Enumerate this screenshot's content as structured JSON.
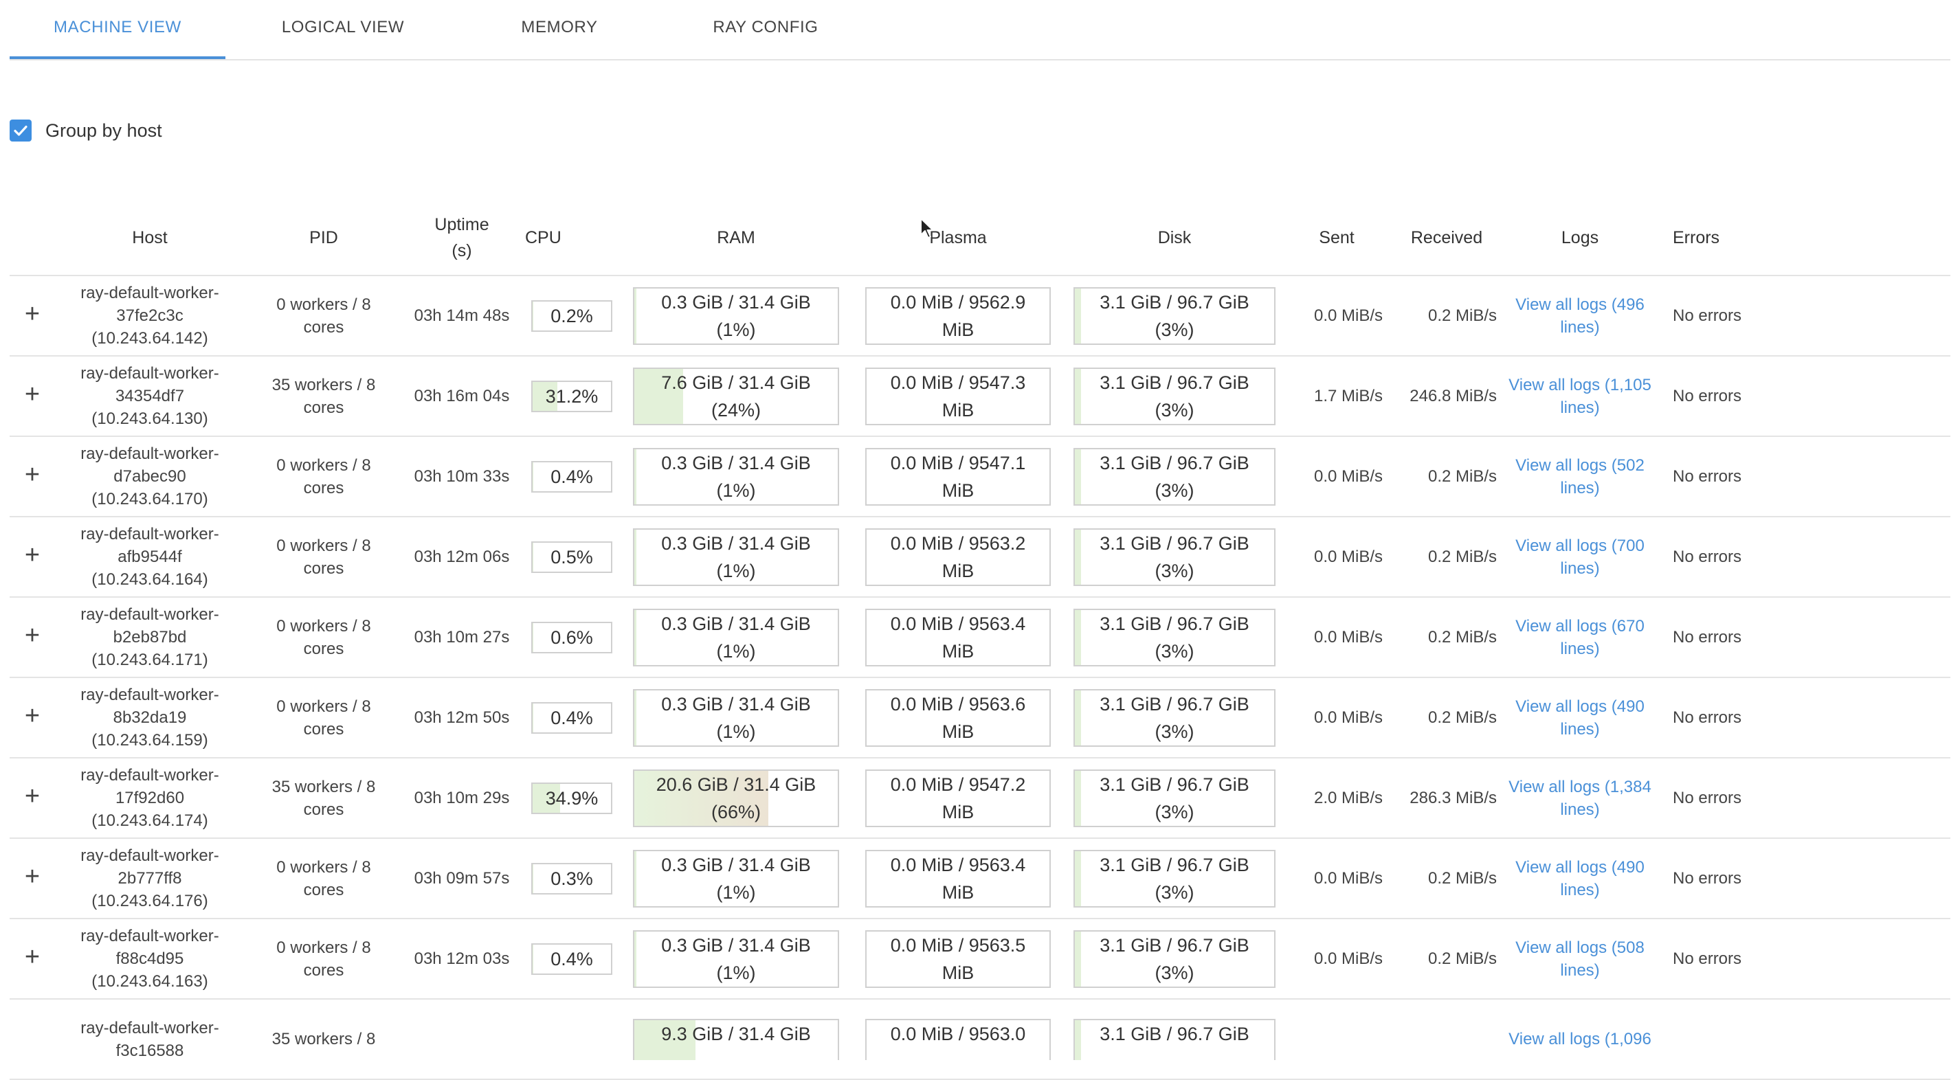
{
  "tabs": [
    "MACHINE VIEW",
    "LOGICAL VIEW",
    "MEMORY",
    "RAY CONFIG"
  ],
  "group_by_host": {
    "label": "Group by host",
    "checked": true
  },
  "columns": [
    "Host",
    "PID",
    "Uptime (s)",
    "CPU",
    "RAM",
    "Plasma",
    "Disk",
    "Sent",
    "Received",
    "Logs",
    "Errors"
  ],
  "rows": [
    {
      "host": "ray-default-worker-37fe2c3c",
      "ip": "(10.243.64.142)",
      "pid_line1": "0 workers / 8",
      "pid_line2": "cores",
      "uptime": "03h 14m 48s",
      "cpu": "0.2%",
      "cpu_pct": 0.2,
      "ram_line1": "0.3 GiB / 31.4 GiB",
      "ram_line2": "(1%)",
      "ram_pct": 1,
      "plasma_line1": "0.0 MiB / 9562.9",
      "plasma_line2": "MiB",
      "disk_line1": "3.1 GiB / 96.7 GiB",
      "disk_line2": "(3%)",
      "disk_pct": 3,
      "sent": "0.0 MiB/s",
      "received": "0.2 MiB/s",
      "logs_line1": "View all logs (496",
      "logs_line2": "lines)",
      "errors": "No errors"
    },
    {
      "host": "ray-default-worker-34354df7",
      "ip": "(10.243.64.130)",
      "pid_line1": "35 workers / 8",
      "pid_line2": "cores",
      "uptime": "03h 16m 04s",
      "cpu": "31.2%",
      "cpu_pct": 31.2,
      "ram_line1": "7.6 GiB / 31.4 GiB",
      "ram_line2": "(24%)",
      "ram_pct": 24,
      "plasma_line1": "0.0 MiB / 9547.3",
      "plasma_line2": "MiB",
      "disk_line1": "3.1 GiB / 96.7 GiB",
      "disk_line2": "(3%)",
      "disk_pct": 3,
      "sent": "1.7 MiB/s",
      "received": "246.8 MiB/s",
      "logs_line1": "View all logs (1,105",
      "logs_line2": "lines)",
      "errors": "No errors"
    },
    {
      "host": "ray-default-worker-d7abec90",
      "ip": "(10.243.64.170)",
      "pid_line1": "0 workers / 8",
      "pid_line2": "cores",
      "uptime": "03h 10m 33s",
      "cpu": "0.4%",
      "cpu_pct": 0.4,
      "ram_line1": "0.3 GiB / 31.4 GiB",
      "ram_line2": "(1%)",
      "ram_pct": 1,
      "plasma_line1": "0.0 MiB / 9547.1",
      "plasma_line2": "MiB",
      "disk_line1": "3.1 GiB / 96.7 GiB",
      "disk_line2": "(3%)",
      "disk_pct": 3,
      "sent": "0.0 MiB/s",
      "received": "0.2 MiB/s",
      "logs_line1": "View all logs (502",
      "logs_line2": "lines)",
      "errors": "No errors"
    },
    {
      "host": "ray-default-worker-afb9544f",
      "ip": "(10.243.64.164)",
      "pid_line1": "0 workers / 8",
      "pid_line2": "cores",
      "uptime": "03h 12m 06s",
      "cpu": "0.5%",
      "cpu_pct": 0.5,
      "ram_line1": "0.3 GiB / 31.4 GiB",
      "ram_line2": "(1%)",
      "ram_pct": 1,
      "plasma_line1": "0.0 MiB / 9563.2",
      "plasma_line2": "MiB",
      "disk_line1": "3.1 GiB / 96.7 GiB",
      "disk_line2": "(3%)",
      "disk_pct": 3,
      "sent": "0.0 MiB/s",
      "received": "0.2 MiB/s",
      "logs_line1": "View all logs (700",
      "logs_line2": "lines)",
      "errors": "No errors"
    },
    {
      "host": "ray-default-worker-b2eb87bd",
      "ip": "(10.243.64.171)",
      "pid_line1": "0 workers / 8",
      "pid_line2": "cores",
      "uptime": "03h 10m 27s",
      "cpu": "0.6%",
      "cpu_pct": 0.6,
      "ram_line1": "0.3 GiB / 31.4 GiB",
      "ram_line2": "(1%)",
      "ram_pct": 1,
      "plasma_line1": "0.0 MiB / 9563.4",
      "plasma_line2": "MiB",
      "disk_line1": "3.1 GiB / 96.7 GiB",
      "disk_line2": "(3%)",
      "disk_pct": 3,
      "sent": "0.0 MiB/s",
      "received": "0.2 MiB/s",
      "logs_line1": "View all logs (670",
      "logs_line2": "lines)",
      "errors": "No errors"
    },
    {
      "host": "ray-default-worker-8b32da19",
      "ip": "(10.243.64.159)",
      "pid_line1": "0 workers / 8",
      "pid_line2": "cores",
      "uptime": "03h 12m 50s",
      "cpu": "0.4%",
      "cpu_pct": 0.4,
      "ram_line1": "0.3 GiB / 31.4 GiB",
      "ram_line2": "(1%)",
      "ram_pct": 1,
      "plasma_line1": "0.0 MiB / 9563.6",
      "plasma_line2": "MiB",
      "disk_line1": "3.1 GiB / 96.7 GiB",
      "disk_line2": "(3%)",
      "disk_pct": 3,
      "sent": "0.0 MiB/s",
      "received": "0.2 MiB/s",
      "logs_line1": "View all logs (490",
      "logs_line2": "lines)",
      "errors": "No errors"
    },
    {
      "host": "ray-default-worker-17f92d60",
      "ip": "(10.243.64.174)",
      "pid_line1": "35 workers / 8",
      "pid_line2": "cores",
      "uptime": "03h 10m 29s",
      "cpu": "34.9%",
      "cpu_pct": 34.9,
      "ram_line1": "20.6 GiB / 31.4 GiB",
      "ram_line2": "(66%)",
      "ram_pct": 66,
      "plasma_line1": "0.0 MiB / 9547.2",
      "plasma_line2": "MiB",
      "disk_line1": "3.1 GiB / 96.7 GiB",
      "disk_line2": "(3%)",
      "disk_pct": 3,
      "sent": "2.0 MiB/s",
      "received": "286.3 MiB/s",
      "logs_line1": "View all logs (1,384",
      "logs_line2": "lines)",
      "errors": "No errors"
    },
    {
      "host": "ray-default-worker-2b777ff8",
      "ip": "(10.243.64.176)",
      "pid_line1": "0 workers / 8",
      "pid_line2": "cores",
      "uptime": "03h 09m 57s",
      "cpu": "0.3%",
      "cpu_pct": 0.3,
      "ram_line1": "0.3 GiB / 31.4 GiB",
      "ram_line2": "(1%)",
      "ram_pct": 1,
      "plasma_line1": "0.0 MiB / 9563.4",
      "plasma_line2": "MiB",
      "disk_line1": "3.1 GiB / 96.7 GiB",
      "disk_line2": "(3%)",
      "disk_pct": 3,
      "sent": "0.0 MiB/s",
      "received": "0.2 MiB/s",
      "logs_line1": "View all logs (490",
      "logs_line2": "lines)",
      "errors": "No errors"
    },
    {
      "host": "ray-default-worker-f88c4d95",
      "ip": "(10.243.64.163)",
      "pid_line1": "0 workers / 8",
      "pid_line2": "cores",
      "uptime": "03h 12m 03s",
      "cpu": "0.4%",
      "cpu_pct": 0.4,
      "ram_line1": "0.3 GiB / 31.4 GiB",
      "ram_line2": "(1%)",
      "ram_pct": 1,
      "plasma_line1": "0.0 MiB / 9563.5",
      "plasma_line2": "MiB",
      "disk_line1": "3.1 GiB / 96.7 GiB",
      "disk_line2": "(3%)",
      "disk_pct": 3,
      "sent": "0.0 MiB/s",
      "received": "0.2 MiB/s",
      "logs_line1": "View all logs (508",
      "logs_line2": "lines)",
      "errors": "No errors"
    }
  ],
  "partial_row": {
    "host": "ray-default-worker-f3c16588",
    "pid_line1": "35 workers / 8",
    "ram_line1": "9.3 GiB / 31.4 GiB",
    "plasma_line1": "0.0 MiB / 9563.0",
    "disk_line1": "3.1 GiB / 96.7 GiB",
    "logs_line1": "View all logs (1,096"
  },
  "colors": {
    "accent": "#4a90d8",
    "bar_fill": "#e3f1d9",
    "bar_fill_high": "#ece3d4",
    "border": "#d0d0d0",
    "divider": "#e4e4e4"
  },
  "icons": {
    "expand": "plus-icon",
    "checkbox": "check-icon",
    "cursor": "mouse-pointer-icon"
  }
}
